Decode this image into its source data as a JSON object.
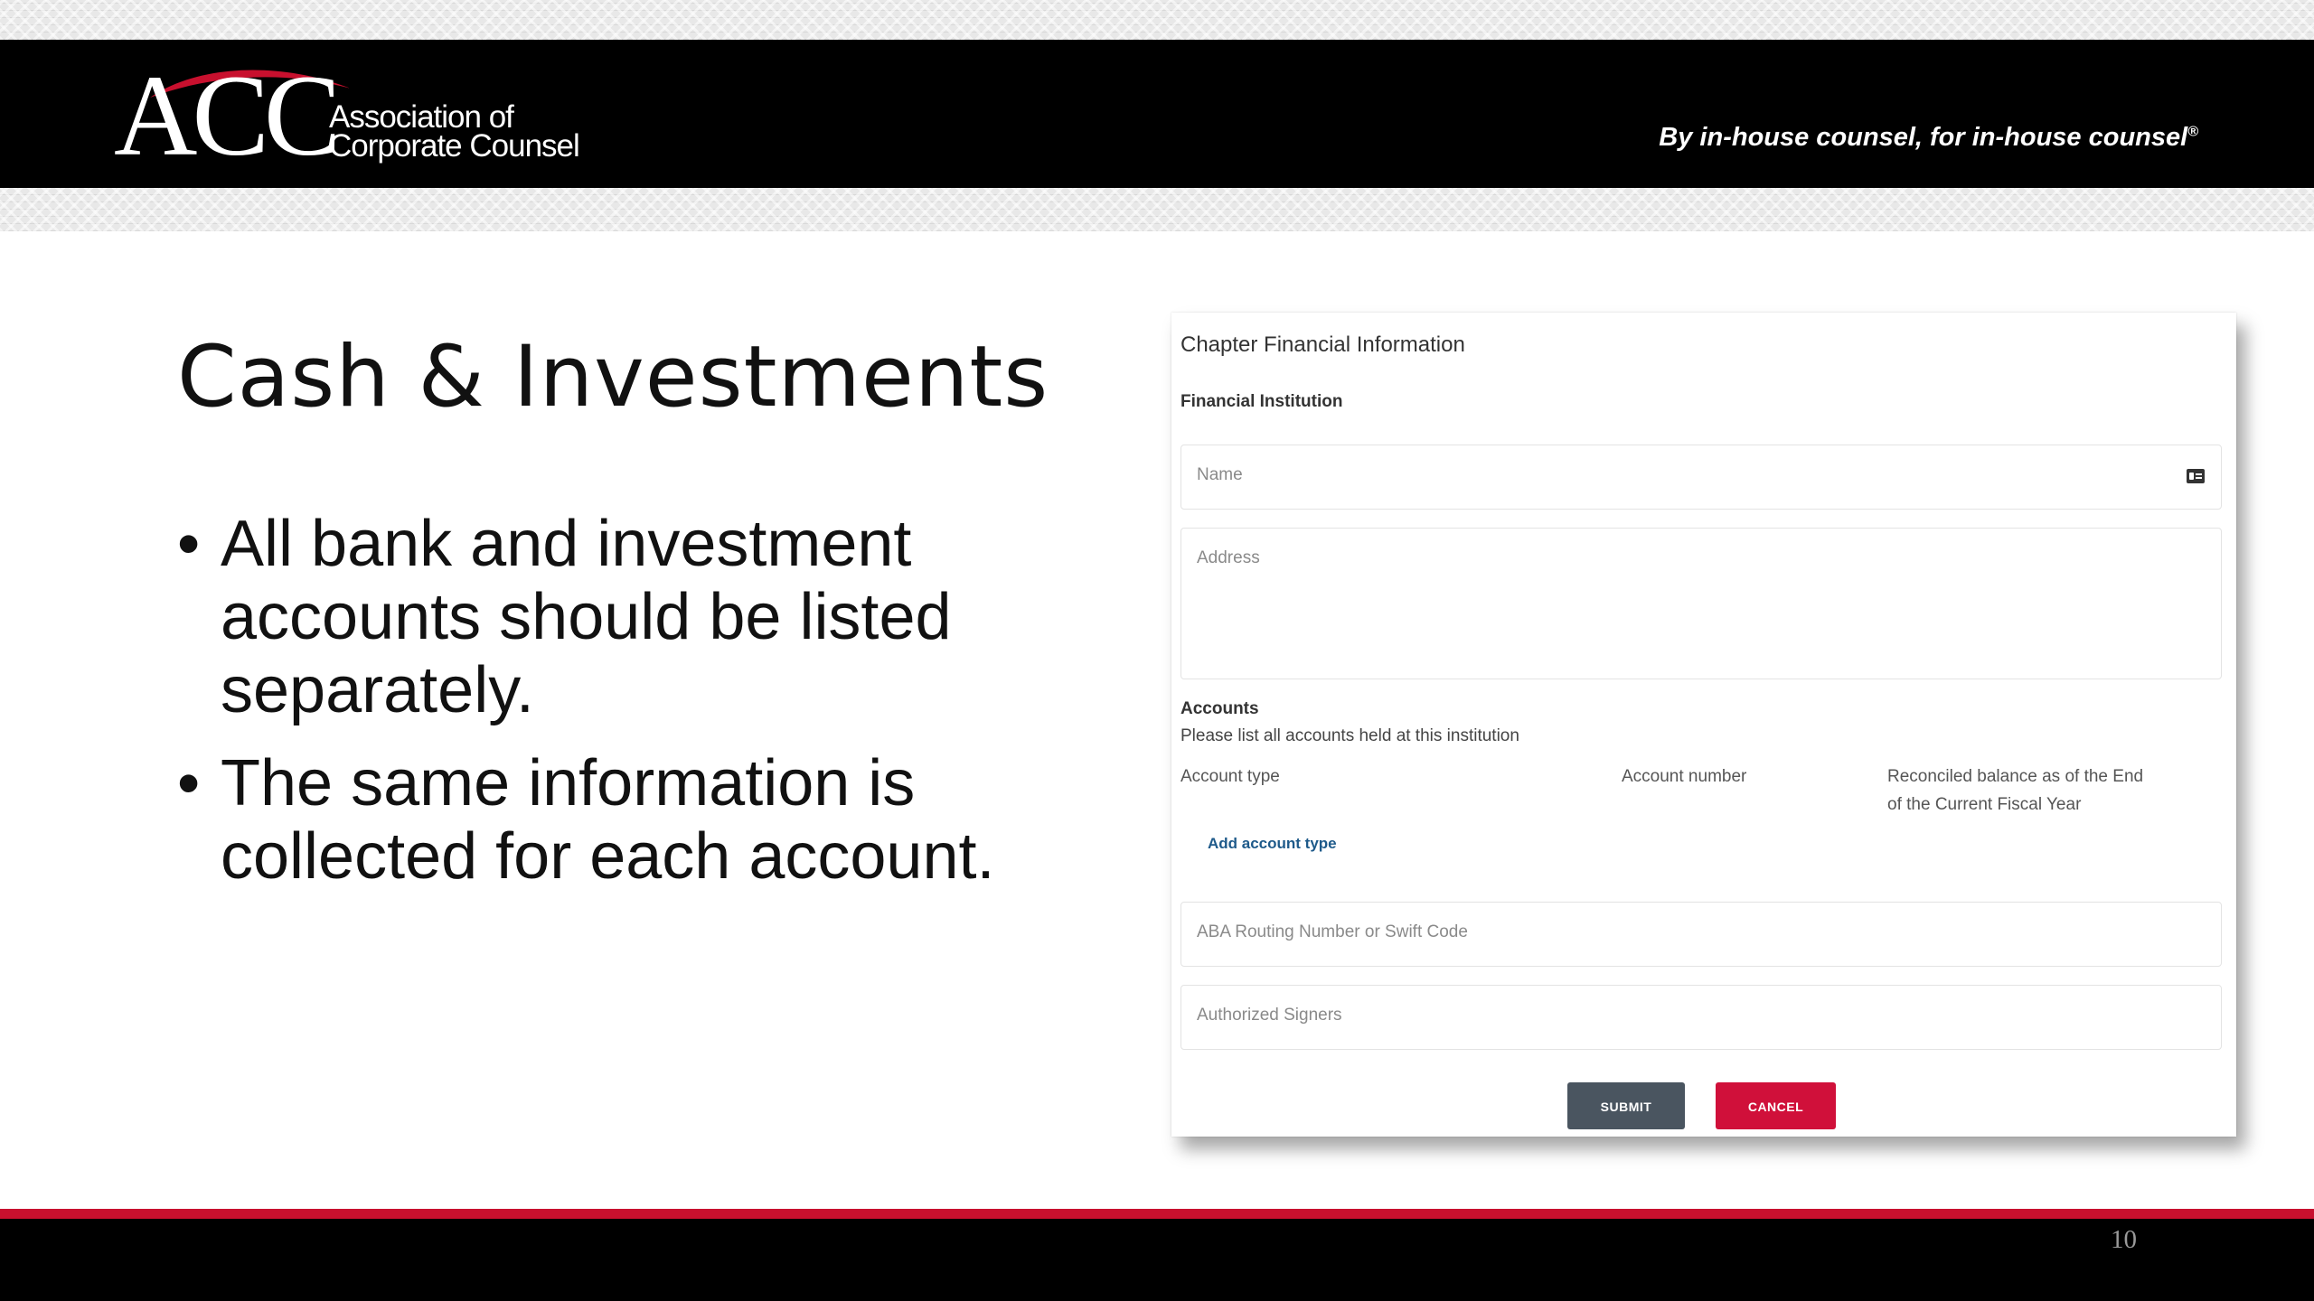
{
  "header": {
    "logo_letters": "ACC",
    "logo_line1": "Association of",
    "logo_line2": "Corporate Counsel",
    "tagline": "By in-house counsel, for in-house counsel",
    "tagline_mark": "®"
  },
  "slide": {
    "title": "Cash & Investments",
    "bullets": [
      "All bank and investment accounts should be listed separately.",
      "The same information is collected for each account."
    ],
    "page_number": "10"
  },
  "form": {
    "title": "Chapter Financial Information",
    "financial_institution_label": "Financial Institution",
    "name_placeholder": "Name",
    "address_placeholder": "Address",
    "accounts_label": "Accounts",
    "accounts_help": "Please list all accounts held at this institution",
    "col_account_type": "Account type",
    "col_account_number": "Account number",
    "col_balance": "Reconciled balance as of the End of the Current Fiscal Year",
    "add_account_type": "Add account type",
    "aba_placeholder": "ABA Routing Number or Swift Code",
    "signers_placeholder": "Authorized Signers",
    "submit_label": "SUBMIT",
    "cancel_label": "CANCEL"
  },
  "colors": {
    "brand_red": "#c8102e",
    "header_black": "#000000",
    "submit_gray": "#4a5560",
    "cancel_red": "#d0103a",
    "link_blue": "#1e5a8a"
  }
}
